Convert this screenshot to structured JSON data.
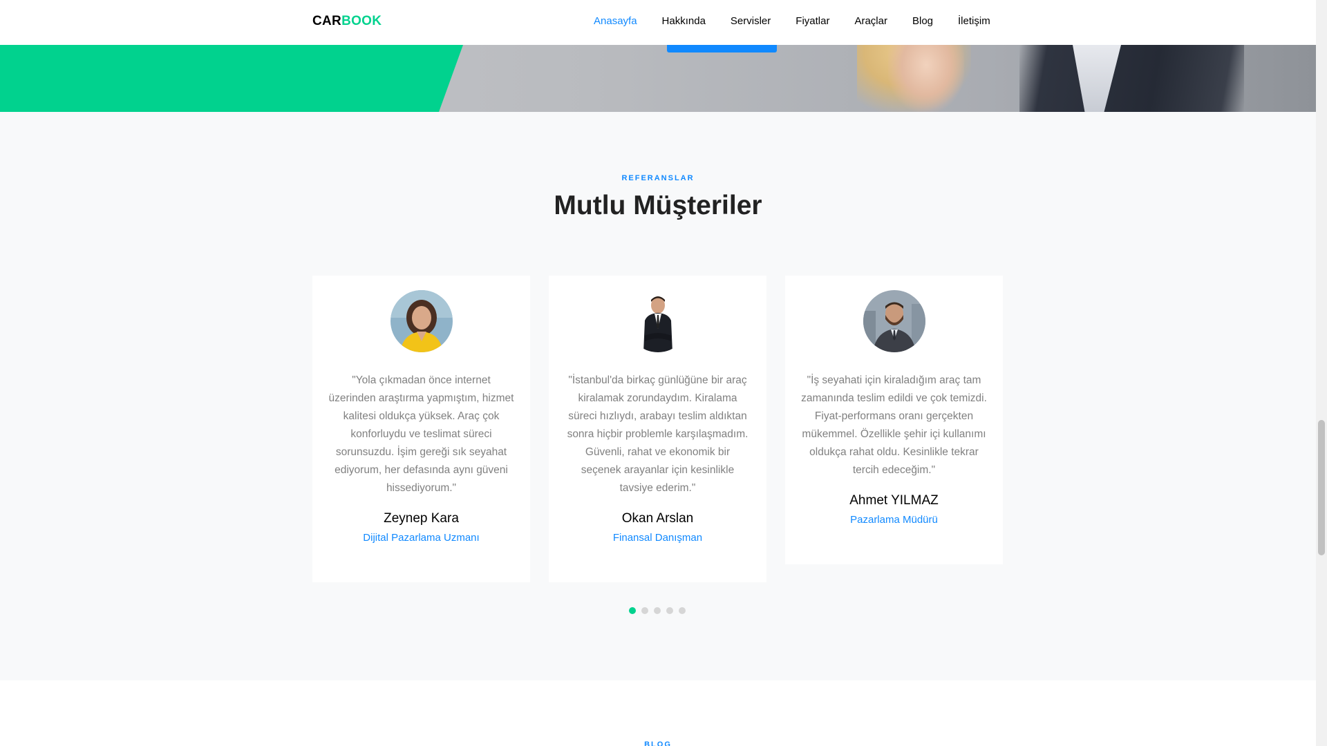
{
  "nav": {
    "logo_part1": "CAR",
    "logo_part2": "BOOK",
    "items": [
      "Anasayfa",
      "Hakkında",
      "Servisler",
      "Fiyatlar",
      "Araçlar",
      "Blog",
      "İletişim"
    ],
    "active": "Anasayfa"
  },
  "section": {
    "subheading": "REFERANSLAR",
    "heading": "Mutlu Müşteriler"
  },
  "testimonials": [
    {
      "quote": "\"Yola çıkmadan önce internet üzerinden araştırma yapmıştım, hizmet kalitesi oldukça yüksek. Araç çok konforluydu ve teslimat süreci sorunsuzdu. İşim gereği sık seyahat ediyorum, her defasında aynı güveni hissediyorum.\"",
      "name": "Zeynep Kara",
      "role": "Dijital Pazarlama Uzmanı",
      "avatar": "woman-yellow-jacket-photo"
    },
    {
      "quote": "\"İstanbul'da birkaç günlüğüne bir araç kiralamak zorundaydım. Kiralama süreci hızlıydı, arabayı teslim aldıktan sonra hiçbir problemle karşılaşmadım. Güvenli, rahat ve ekonomik bir seçenek arayanlar için kesinlikle tavsiye ederim.\"",
      "name": "Okan Arslan",
      "role": "Finansal Danışman",
      "avatar": "man-in-suit-photo"
    },
    {
      "quote": "\"İş seyahati için kiraladığım araç tam zamanında teslim edildi ve çok temizdi. Fiyat-performans oranı gerçekten mükemmel. Özellikle şehir içi kullanımı oldukça rahat oldu. Kesinlikle tekrar tercih edeceğim.\"",
      "name": "Ahmet YILMAZ",
      "role": "Pazarlama Müdürü",
      "avatar": "bearded-man-photo"
    }
  ],
  "carousel": {
    "total_dots": 5,
    "active_index": 0
  },
  "blog": {
    "label": "BLOG"
  },
  "colors": {
    "accent_green": "#01d28e",
    "accent_blue": "#1089ff"
  }
}
